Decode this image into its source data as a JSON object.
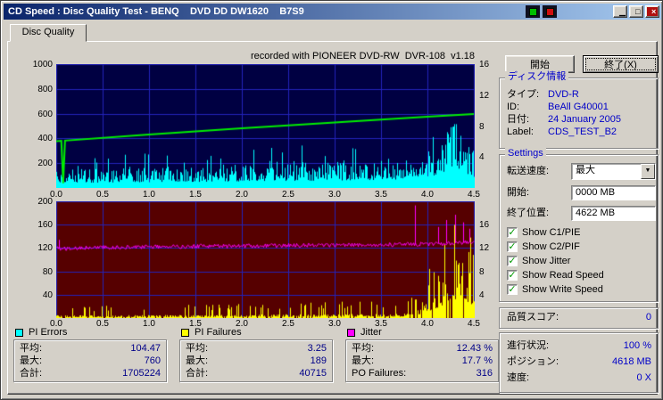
{
  "window": {
    "title": "CD Speed : Disc Quality Test - BENQ    DVD DD DW1620    B7S9"
  },
  "titlebar": {
    "minimize": "▁",
    "maximize": "□",
    "close": "×"
  },
  "tab": {
    "label": "Disc Quality"
  },
  "recorded_note": "recorded with PIONEER DVD-RW  DVR-108  v1.18",
  "buttons": {
    "start": "開始",
    "exit": "終了(X)"
  },
  "disc_info": {
    "caption": "ディスク情報",
    "rows": [
      {
        "label": "タイプ:",
        "value": "DVD-R"
      },
      {
        "label": "ID:",
        "value": "BeAll G40001"
      },
      {
        "label": "日付:",
        "value": "24 January 2005"
      },
      {
        "label": "Label:",
        "value": "CDS_TEST_B2"
      }
    ]
  },
  "settings": {
    "caption": "Settings",
    "transfer_label": "転送速度:",
    "transfer_value": "最大",
    "start_label": "開始:",
    "start_value": "0000 MB",
    "end_label": "終了位置:",
    "end_value": "4622 MB",
    "checkboxes": [
      {
        "label": "Show C1/PIE",
        "checked": true
      },
      {
        "label": "Show C2/PIF",
        "checked": true
      },
      {
        "label": "Show Jitter",
        "checked": true
      },
      {
        "label": "Show Read Speed",
        "checked": true
      },
      {
        "label": "Show Write Speed",
        "checked": true
      }
    ]
  },
  "quality": {
    "label": "品質スコア:",
    "value": "0"
  },
  "progress": {
    "rows": [
      {
        "label": "進行状況:",
        "value": "100 %"
      },
      {
        "label": "ポジション:",
        "value": "4618 MB"
      },
      {
        "label": "速度:",
        "value": "0 X"
      }
    ]
  },
  "stat_boxes": [
    {
      "legend": "PI Errors",
      "color": "#00ffff",
      "rows": [
        {
          "label": "平均:",
          "value": "104.47"
        },
        {
          "label": "最大:",
          "value": "760"
        },
        {
          "label": "合計:",
          "value": "1705224"
        }
      ]
    },
    {
      "legend": "PI Failures",
      "color": "#ffff00",
      "rows": [
        {
          "label": "平均:",
          "value": "3.25"
        },
        {
          "label": "最大:",
          "value": "189"
        },
        {
          "label": "合計:",
          "value": "40715"
        }
      ]
    },
    {
      "legend": "Jitter",
      "color": "#ff00ff",
      "rows": [
        {
          "label": "平均:",
          "value": "12.43 %"
        },
        {
          "label": "最大:",
          "value": "17.7 %"
        },
        {
          "label": "PO Failures:",
          "value": "316"
        }
      ]
    }
  ],
  "icons": {
    "combo_arrow": "▼",
    "check": "✓"
  },
  "colors": {
    "window_bg": "#d4d0c8",
    "titlebar_start": "#0a246a",
    "titlebar_end": "#a6caf0",
    "caption_blue": "#0000cc",
    "value_blue": "#0000c8",
    "stat_value": "#000088",
    "check_green": "#009900",
    "close_red": "#b01010"
  },
  "chart_data": [
    {
      "type": "area",
      "title": "recorded with PIONEER DVD-RW  DVR-108  v1.18",
      "plot_bg": "#000042",
      "grid_color": "#2323bb",
      "x_range": [
        0,
        4.5
      ],
      "x_ticks": [
        0,
        0.5,
        1,
        1.5,
        2,
        2.5,
        3,
        3.5,
        4,
        4.5
      ],
      "x_tick_labels": [
        "0.0",
        "0.5",
        "1.0",
        "1.5",
        "2.0",
        "2.5",
        "3.0",
        "3.5",
        "4.0",
        "4.5"
      ],
      "left_axis": {
        "range": [
          0,
          1000
        ],
        "ticks": [
          1000,
          800,
          600,
          400,
          200
        ]
      },
      "right_axis": {
        "range": [
          0,
          16
        ],
        "ticks": [
          16,
          12,
          8,
          4
        ]
      },
      "series": [
        {
          "name": "PI Errors",
          "color": "#00ffff",
          "style": "spikes",
          "axis": "left",
          "stats": {
            "avg": 104.47,
            "max": 760,
            "total": 1705224
          },
          "envelope": [
            [
              0,
              150,
              280
            ],
            [
              0.5,
              155,
              285
            ],
            [
              1,
              165,
              300
            ],
            [
              1.5,
              175,
              305
            ],
            [
              2,
              190,
              320
            ],
            [
              2.5,
              205,
              340
            ],
            [
              3,
              215,
              355
            ],
            [
              3.5,
              235,
              380
            ],
            [
              3.95,
              260,
              420
            ],
            [
              4.1,
              390,
              650
            ],
            [
              4.25,
              530,
              790
            ],
            [
              4.35,
              505,
              760
            ],
            [
              4.45,
              380,
              620
            ],
            [
              4.5,
              300,
              520
            ]
          ],
          "spike_prob": 0.08
        },
        {
          "name": "Read Speed",
          "color": "#00ee00",
          "style": "line",
          "axis": "right",
          "points": [
            [
              0,
              6.05
            ],
            [
              0.055,
              6.1
            ],
            [
              0.075,
              0.6
            ],
            [
              0.095,
              6.12
            ],
            [
              1,
              6.9
            ],
            [
              2,
              7.7
            ],
            [
              3,
              8.45
            ],
            [
              4,
              9.2
            ],
            [
              4.5,
              9.55
            ]
          ]
        }
      ]
    },
    {
      "type": "area",
      "plot_bg": "#560000",
      "grid_color": "#2323bb",
      "x_range": [
        0,
        4.5
      ],
      "x_ticks": [
        0,
        0.5,
        1,
        1.5,
        2,
        2.5,
        3,
        3.5,
        4,
        4.5
      ],
      "x_tick_labels": [
        "0.0",
        "0.5",
        "1.0",
        "1.5",
        "2.0",
        "2.5",
        "3.0",
        "3.5",
        "4.0",
        "4.5"
      ],
      "left_axis": {
        "range": [
          0,
          200
        ],
        "ticks": [
          200,
          160,
          120,
          80,
          40
        ]
      },
      "right_axis": {
        "range": [
          0,
          20
        ],
        "ticks": [
          16,
          12,
          8,
          4
        ]
      },
      "series": [
        {
          "name": "PI Failures",
          "color": "#ffff00",
          "style": "spikes",
          "axis": "left",
          "stats": {
            "avg": 3.25,
            "max": 189,
            "total": 40715
          },
          "envelope": [
            [
              0,
              5,
              20
            ],
            [
              1,
              5,
              22
            ],
            [
              2,
              6,
              25
            ],
            [
              3,
              7,
              28
            ],
            [
              3.7,
              8,
              34
            ],
            [
              3.9,
              20,
              60
            ],
            [
              4.05,
              48,
              110
            ],
            [
              4.2,
              85,
              150
            ],
            [
              4.35,
              115,
              189
            ],
            [
              4.45,
              95,
              160
            ],
            [
              4.5,
              70,
              130
            ]
          ],
          "spike_prob": 0.12,
          "presence": 0.85
        },
        {
          "name": "Jitter",
          "color": "#ff00ff",
          "style": "noisy-line",
          "axis": "right",
          "stats": {
            "avg": 12.43,
            "max": 17.7,
            "po_failures": 316
          },
          "center": [
            [
              0,
              11.9
            ],
            [
              0.5,
              12.1
            ],
            [
              1,
              12.2
            ],
            [
              1.5,
              12.3
            ],
            [
              2,
              12.35
            ],
            [
              2.5,
              12.45
            ],
            [
              3,
              12.5
            ],
            [
              3.5,
              12.55
            ],
            [
              4,
              12.7
            ],
            [
              4.5,
              13.0
            ]
          ],
          "noise": 0.35,
          "spikes": [
            [
              0.03,
              13.4
            ],
            [
              3.87,
              19.3
            ],
            [
              4.12,
              15.6
            ],
            [
              4.2,
              16.8
            ],
            [
              4.3,
              17.7
            ],
            [
              4.38,
              16.4
            ],
            [
              4.45,
              15.3
            ]
          ]
        }
      ]
    }
  ]
}
